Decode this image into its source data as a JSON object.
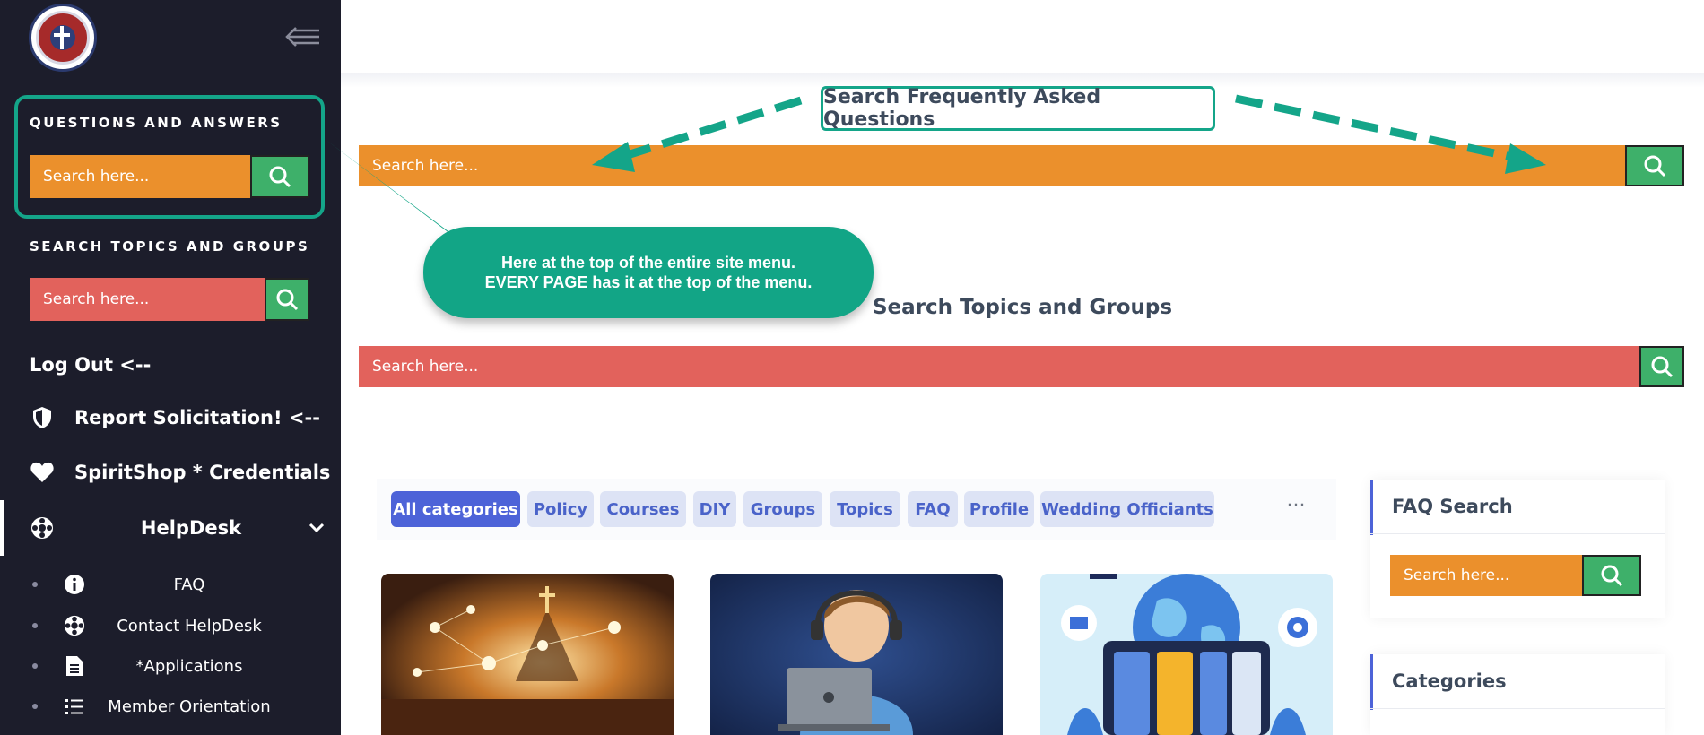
{
  "sidebar": {
    "qa_heading": "QUESTIONS AND ANSWERS",
    "qa_search_placeholder": "Search here...",
    "topics_heading": "SEARCH TOPICS AND GROUPS",
    "topics_search_placeholder": "Search here...",
    "logout": "Log Out <--",
    "report": "Report Solicitation! <--",
    "spiritshop": "SpiritShop * Credentials",
    "helpdesk": "HelpDesk",
    "sub_items": [
      {
        "label": "FAQ",
        "icon": "info-icon"
      },
      {
        "label": "Contact HelpDesk",
        "icon": "lifebuoy-icon"
      },
      {
        "label": "*Applications",
        "icon": "document-icon"
      },
      {
        "label": "Member Orientation",
        "icon": "list-icon"
      }
    ]
  },
  "main": {
    "faq_title": "Search Frequently Asked Questions",
    "faq_search_placeholder": "Search here...",
    "topics_title": "Search Topics and Groups",
    "topics_search_placeholder": "Search here...",
    "callout_line1": "Here at the top of the entire site menu.",
    "callout_line2": "EVERY PAGE has it at the top of the menu.",
    "categories": [
      "All categories",
      "Policy",
      "Courses",
      "DIY",
      "Groups",
      "Topics",
      "FAQ",
      "Profile",
      "Wedding Officiants"
    ],
    "more": "···"
  },
  "widgets": {
    "faq_search_title": "FAQ Search",
    "faq_search_placeholder": "Search here...",
    "categories_title": "Categories"
  },
  "colors": {
    "sidebar_bg": "#1c1d2b",
    "teal_annotation": "#14a589",
    "orange_search": "#eb902c",
    "red_search": "#e2625c",
    "green_button": "#3eb06a",
    "accent_blue": "#4d63d8"
  }
}
